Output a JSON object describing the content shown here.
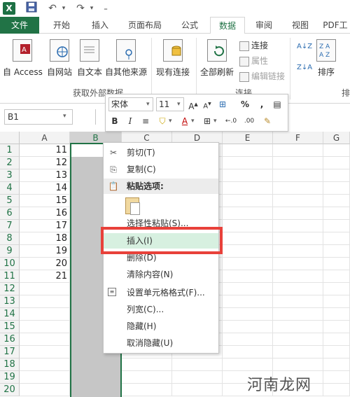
{
  "quick_access": {
    "logo_label": "X",
    "save_icon": "save-icon",
    "undo_icon": "undo-icon",
    "redo_icon": "redo-icon"
  },
  "tabs": [
    {
      "label": "文件"
    },
    {
      "label": "开始"
    },
    {
      "label": "插入"
    },
    {
      "label": "页面布局"
    },
    {
      "label": "公式"
    },
    {
      "label": "数据"
    },
    {
      "label": "审阅"
    },
    {
      "label": "视图"
    },
    {
      "label": "PDF工"
    }
  ],
  "ribbon": {
    "external_group_label": "获取外部数据",
    "connections_group_label": "连接",
    "sort_group_label": "排",
    "buttons": {
      "access": "自 Access",
      "web": "自网站",
      "text": "自文本",
      "other": "自其他来源",
      "existing": "现有连接",
      "refresh_all": "全部刷新",
      "sort": "排序"
    },
    "small": {
      "connections": "连接",
      "properties": "属性",
      "edit_links": "编辑链接"
    }
  },
  "formula_bar": {
    "namebox": "B1"
  },
  "grid": {
    "columns": [
      "A",
      "B",
      "C",
      "D",
      "E",
      "F",
      "G"
    ],
    "rows": [
      "1",
      "2",
      "3",
      "4",
      "5",
      "6",
      "7",
      "8",
      "9",
      "10",
      "11",
      "12",
      "13",
      "14",
      "15",
      "16",
      "17",
      "18",
      "19",
      "20"
    ],
    "colA_values": [
      "11",
      "12",
      "13",
      "14",
      "15",
      "16",
      "17",
      "18",
      "19",
      "20",
      "21"
    ]
  },
  "mini_toolbar": {
    "font": "宋体",
    "size": "11",
    "bold": "B",
    "italic": "I",
    "percent": "%",
    "comma": ","
  },
  "context_menu": {
    "cut": "剪切(T)",
    "copy": "复制(C)",
    "paste_options": "粘贴选项:",
    "paste_special": "选择性粘贴(S)...",
    "insert": "插入(I)",
    "delete": "删除(D)",
    "clear": "清除内容(N)",
    "format_cells": "设置单元格格式(F)...",
    "column_width": "列宽(C)...",
    "hide": "隐藏(H)",
    "unhide": "取消隐藏(U)"
  },
  "watermark": "河南龙网",
  "colors": {
    "accent": "#217346",
    "highlight_box": "#e8413a",
    "selection_fill": "#c6c6c6"
  }
}
